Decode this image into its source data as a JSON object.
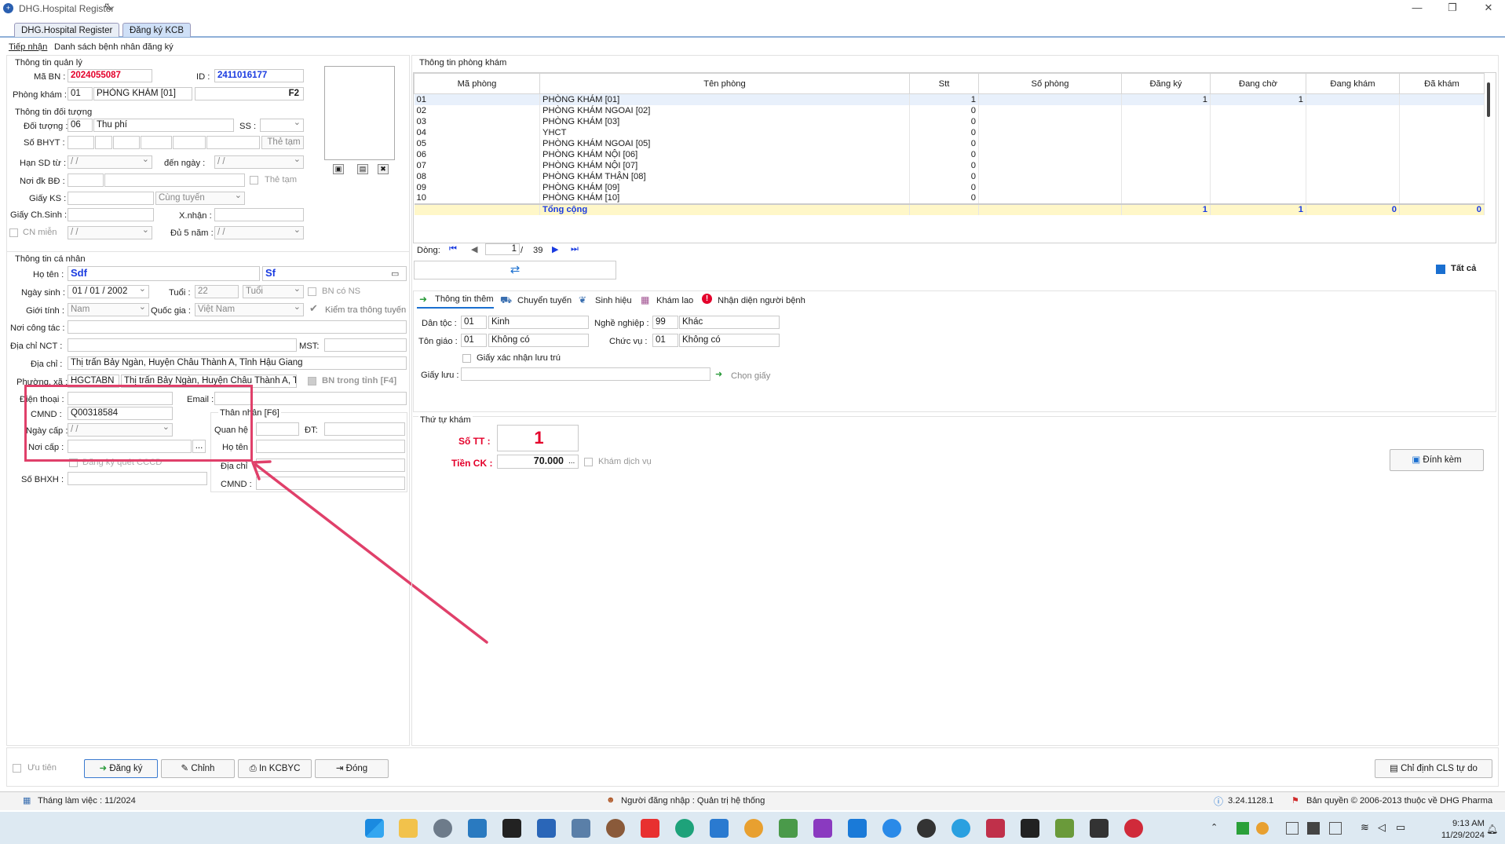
{
  "window": {
    "title": "DHG.Hospital Register"
  },
  "app_tabs": [
    "DHG.Hospital Register",
    "Đăng ký KCB"
  ],
  "sub_tabs": [
    "Tiếp nhận",
    "Danh sách bệnh nhân đăng ký"
  ],
  "management": {
    "group": "Thông tin quản lý",
    "ma_bn_label": "Mã BN :",
    "ma_bn": "2024055087",
    "id_label": "ID :",
    "id": "2411016177",
    "phong_kham_label": "Phòng khám :",
    "phong_kham_code": "01",
    "phong_kham_name": "PHÒNG KHÁM [01]",
    "f2": "F2"
  },
  "subject": {
    "group": "Thông tin đối tượng",
    "doi_tuong_label": "Đối tượng :",
    "doi_tuong_code": "06",
    "doi_tuong_name": "Thu phí",
    "ss_label": "SS :",
    "so_bhyt_label": "Số BHYT :",
    "the_tam_btn": "Thẻ tạm",
    "han_sd_label": "Hạn SD từ :",
    "date_blank": "  /    /",
    "den_ngay_label": "đến  ngày :",
    "noi_dk_label": "Nơi đk BĐ :",
    "the_tam_chk": "Thẻ tạm",
    "giay_ks_label": "Giấy KS :",
    "cung_tuyen": "Cùng tuyến",
    "giay_chsinh_label": "Giấy Ch.Sinh :",
    "xnhan_label": "X.nhận :",
    "cn_mien_label": "CN miễn",
    "du5nam_label": "Đủ 5 năm :"
  },
  "personal": {
    "group": "Thông tin cá nhân",
    "ho_ten_label": "Họ tên :",
    "ho": "Sdf",
    "ten": "Sf",
    "ngay_sinh_label": "Ngày sinh :",
    "ngay_sinh": "01 / 01 / 2002",
    "tuoi_label": "Tuổi :",
    "tuoi": "22",
    "tuoi_unit": "Tuổi",
    "bn_co_ns": "BN có NS",
    "gioi_tinh_label": "Giới tính :",
    "gioi_tinh": "Nam",
    "quoc_gia_label": "Quốc gia :",
    "quoc_gia": "Việt Nam",
    "kiem_tra": "Kiểm tra thông tuyến",
    "noi_cong_tac_label": "Nơi công tác :",
    "dia_chi_nct_label": "Địa chỉ  NCT :",
    "mst_label": "MST:",
    "dia_chi_label": "Địa chỉ :",
    "dia_chi": "Thị trấn Bảy Ngàn, Huyện Châu Thành A, Tỉnh Hậu Giang",
    "phuong_xa_label": "Phường, xã :",
    "phuong_xa_code": "HGCTABN",
    "phuong_xa_name": "Thị trấn Bảy Ngàn, Huyện Châu Thành A, Tỉnh",
    "bn_trong_tinh": "BN trong tỉnh [F4]",
    "dien_thoai_label": "Điện thoại :",
    "email_label": "Email :",
    "cmnd_label": "CMND :",
    "cmnd": "Q00318584",
    "ngay_cap_label": "Ngày cấp :",
    "noi_cap_label": "Nơi cấp :",
    "dots": "...",
    "dang_ky_quet": "Đăng ký quét CCCD",
    "so_bhxh_label": "Số BHXH :",
    "than_nhan_group": "Thân nhân [F6]",
    "quan_he_label": "Quan hệ",
    "dt_label": "ĐT:",
    "ho_ten2_label": "Họ tên",
    "dia_chi2_label": "Địa chỉ",
    "cmnd2_label": "CMND :"
  },
  "rooms": {
    "group": "Thông tin phòng khám",
    "columns": [
      "Mã phòng",
      "Tên phòng",
      "Stt",
      "Số phòng",
      "Đăng ký",
      "Đang chờ",
      "Đang khám",
      "Đã khám"
    ],
    "rows": [
      [
        "01",
        "PHÒNG KHÁM [01]",
        "1",
        "",
        "1",
        "1",
        "",
        ""
      ],
      [
        "02",
        "PHÒNG KHÁM NGOAI [02]",
        "0",
        "",
        "",
        "",
        "",
        ""
      ],
      [
        "03",
        "PHÒNG KHÁM [03]",
        "0",
        "",
        "",
        "",
        "",
        ""
      ],
      [
        "04",
        "YHCT",
        "0",
        "",
        "",
        "",
        "",
        ""
      ],
      [
        "05",
        "PHÒNG KHÁM NGOAI [05]",
        "0",
        "",
        "",
        "",
        "",
        ""
      ],
      [
        "06",
        "PHÒNG KHÁM NỘI [06]",
        "0",
        "",
        "",
        "",
        "",
        ""
      ],
      [
        "07",
        "PHÒNG KHÁM NỘI [07]",
        "0",
        "",
        "",
        "",
        "",
        ""
      ],
      [
        "08",
        "PHÒNG KHÁM THẬN [08]",
        "0",
        "",
        "",
        "",
        "",
        ""
      ],
      [
        "09",
        "PHÒNG KHÁM [09]",
        "0",
        "",
        "",
        "",
        "",
        ""
      ],
      [
        "10",
        "PHÒNG KHÁM [10]",
        "0",
        "",
        "",
        "",
        "",
        ""
      ]
    ],
    "total_label": "Tổng cộng",
    "total": [
      "1",
      "1",
      "0",
      "0"
    ],
    "nav_label": "Dòng:",
    "page": "1",
    "of": "/",
    "pages": "39",
    "tat_ca": "Tất cả"
  },
  "info_tabs": [
    "Thông tin thêm",
    "Chuyển tuyến",
    "Sinh hiệu",
    "Khám lao",
    "Nhận diện người bệnh"
  ],
  "extra": {
    "dan_toc_label": "Dân tộc :",
    "dan_toc_code": "01",
    "dan_toc": "Kinh",
    "nghe_nghiep_label": "Nghề nghiệp :",
    "nghe_nghiep_code": "99",
    "nghe_nghiep": "Khác",
    "ton_giao_label": "Tôn giáo :",
    "ton_giao_code": "01",
    "ton_giao": "Không có",
    "chuc_vu_label": "Chức vụ :",
    "chuc_vu_code": "01",
    "chuc_vu": "Không có",
    "giay_xac_nhan": "Giấy xác nhận lưu trú",
    "giay_luu_label": "Giấy lưu :",
    "chon_giay": "Chọn giấy"
  },
  "order": {
    "group": "Thứ tự khám",
    "so_tt_label": "Số TT :",
    "so_tt": "1",
    "tien_ck_label": "Tiền CK :",
    "tien_ck": "70.000",
    "dots": "...",
    "kham_dich_vu": "Khám dịch vụ",
    "dinh_kem": "Đính kèm"
  },
  "footer": {
    "uu_tien": "Ưu tiên",
    "dang_ky": "Đăng ký",
    "chinh": "Chỉnh",
    "in_kcbyc": "In KCBYC",
    "dong": "Đóng",
    "chi_dinh": "Chỉ định CLS tự do"
  },
  "status": {
    "thang": "Tháng làm việc : 11/2024",
    "nguoi": "Người đăng nhập : Quản trị hệ thống",
    "version": "3.24.1128.1",
    "copyright": "Bản quyền © 2006-2013 thuộc về DHG Pharma"
  },
  "clock": {
    "time": "9:13 AM",
    "date": "11/29/2024"
  },
  "colors": {
    "accent": "#1a6fd0",
    "highlight_red": "#e0406a",
    "total_row": "#fff7c8"
  }
}
